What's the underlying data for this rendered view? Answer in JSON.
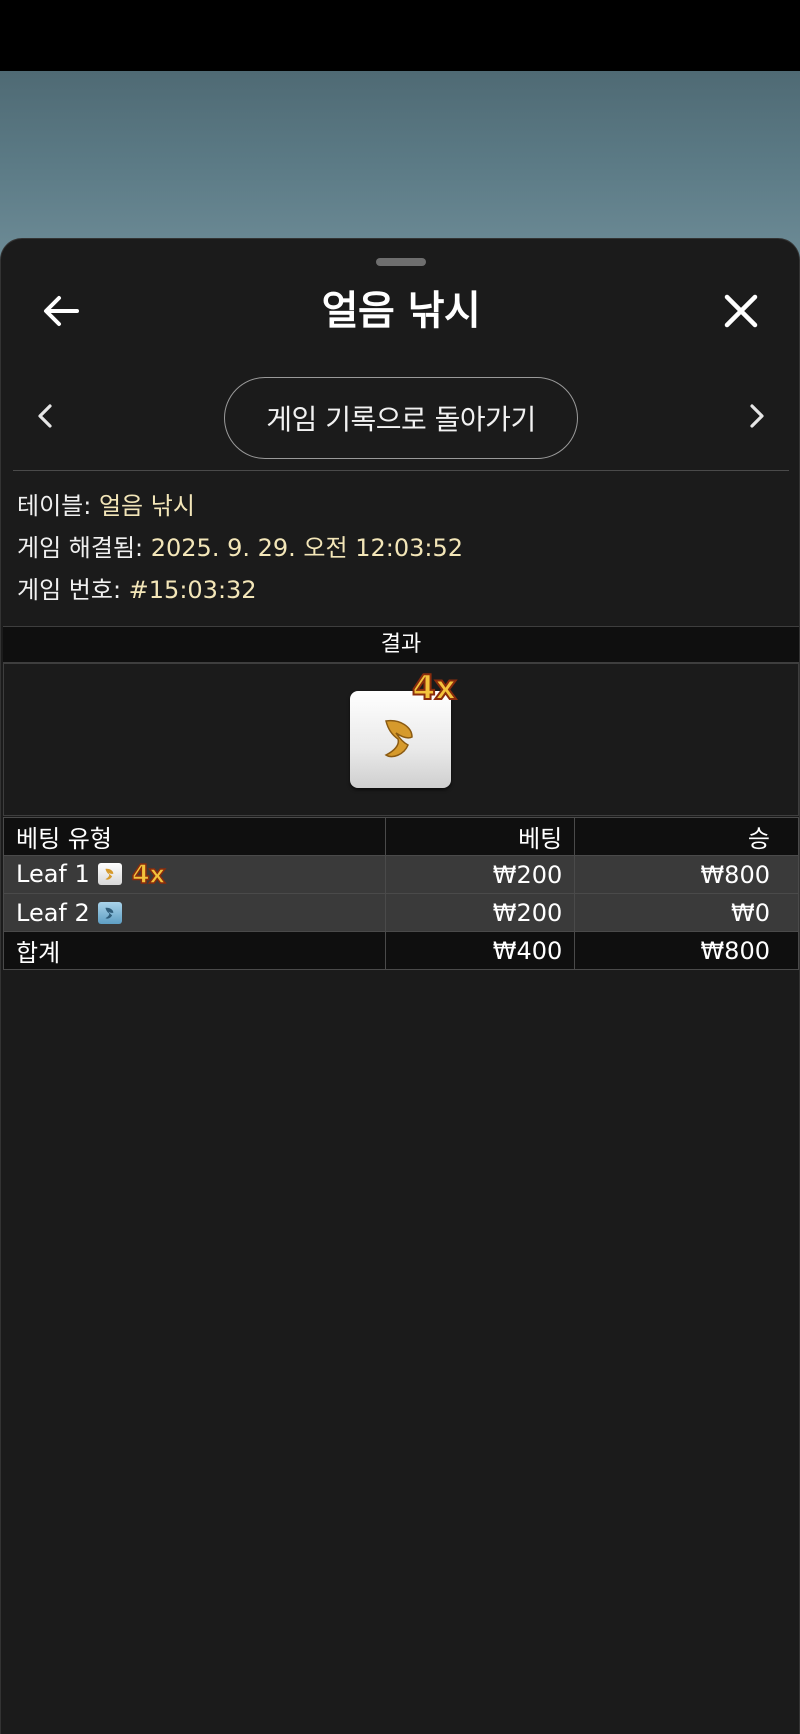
{
  "header": {
    "title": "얼음 낚시",
    "history_button_label": "게임 기록으로 돌아가기"
  },
  "info": {
    "table_label": "테이블: ",
    "table_value": "얼음 낚시",
    "resolved_label": "게임 해결됨: ",
    "resolved_value": "2025. 9. 29. 오전 12:03:52",
    "round_label": "게임 번호: ",
    "round_value": "#15:03:32"
  },
  "result": {
    "header": "결과",
    "multiplier": "4x",
    "tile_icon": "leaf-tile-icon"
  },
  "bets": {
    "columns": [
      "베팅 유형",
      "베팅",
      "승"
    ],
    "rows": [
      {
        "type": "Leaf 1",
        "multiplier": "4x",
        "bet": "₩200",
        "win": "₩800"
      },
      {
        "type": "Leaf 2",
        "multiplier": "",
        "bet": "₩200",
        "win": "₩0"
      }
    ],
    "total": {
      "type": "합계",
      "bet": "₩400",
      "win": "₩800"
    }
  },
  "colors": {
    "sheet_bg": "#1b1b1b",
    "value_text": "#f3e6b8",
    "multiplier_gold": "#f3c23c"
  }
}
